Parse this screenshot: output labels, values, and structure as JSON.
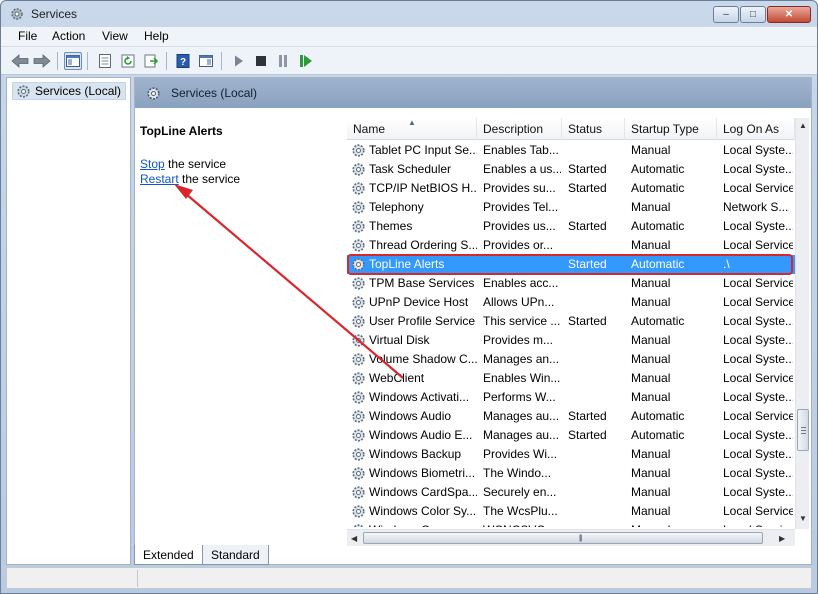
{
  "window": {
    "title": "Services",
    "minimize_glyph": "–",
    "maximize_glyph": "□",
    "close_glyph": "✕"
  },
  "menu": {
    "file": "File",
    "action": "Action",
    "view": "View",
    "help": "Help"
  },
  "toolbar": {
    "buttons": [
      "back-icon",
      "forward-icon",
      "show-hide-console-tree-icon",
      "properties-icon",
      "refresh-icon",
      "export-list-icon",
      "help-icon",
      "action-pane-icon",
      "start-service-icon",
      "stop-service-icon",
      "pause-service-icon",
      "restart-service-icon"
    ]
  },
  "tree": {
    "item_label": "Services (Local)"
  },
  "main": {
    "header_title": "Services (Local)"
  },
  "description": {
    "service_title": "TopLine Alerts",
    "stop_link": "Stop",
    "stop_rest": " the service",
    "restart_link": "Restart",
    "restart_rest": " the service"
  },
  "columns": {
    "name": "Name",
    "description": "Description",
    "status": "Status",
    "startup_type": "Startup Type",
    "log_on_as": "Log On As"
  },
  "services": [
    {
      "name": "Tablet PC Input Se...",
      "description": "Enables Tab...",
      "status": "",
      "startup": "Manual",
      "logon": "Local Syste..."
    },
    {
      "name": "Task Scheduler",
      "description": "Enables a us...",
      "status": "Started",
      "startup": "Automatic",
      "logon": "Local Syste..."
    },
    {
      "name": "TCP/IP NetBIOS H...",
      "description": "Provides su...",
      "status": "Started",
      "startup": "Automatic",
      "logon": "Local Service"
    },
    {
      "name": "Telephony",
      "description": "Provides Tel...",
      "status": "",
      "startup": "Manual",
      "logon": "Network S..."
    },
    {
      "name": "Themes",
      "description": "Provides us...",
      "status": "Started",
      "startup": "Automatic",
      "logon": "Local Syste..."
    },
    {
      "name": "Thread Ordering S...",
      "description": "Provides or...",
      "status": "",
      "startup": "Manual",
      "logon": "Local Service"
    },
    {
      "name": "TopLine Alerts",
      "description": "",
      "status": "Started",
      "startup": "Automatic",
      "logon": ".\\"
    },
    {
      "name": "TPM Base Services",
      "description": "Enables acc...",
      "status": "",
      "startup": "Manual",
      "logon": "Local Service"
    },
    {
      "name": "UPnP Device Host",
      "description": "Allows UPn...",
      "status": "",
      "startup": "Manual",
      "logon": "Local Service"
    },
    {
      "name": "User Profile Service",
      "description": "This service ...",
      "status": "Started",
      "startup": "Automatic",
      "logon": "Local Syste..."
    },
    {
      "name": "Virtual Disk",
      "description": "Provides m...",
      "status": "",
      "startup": "Manual",
      "logon": "Local Syste..."
    },
    {
      "name": "Volume Shadow C...",
      "description": "Manages an...",
      "status": "",
      "startup": "Manual",
      "logon": "Local Syste..."
    },
    {
      "name": "WebClient",
      "description": "Enables Win...",
      "status": "",
      "startup": "Manual",
      "logon": "Local Service"
    },
    {
      "name": "Windows Activati...",
      "description": "Performs W...",
      "status": "",
      "startup": "Manual",
      "logon": "Local Syste..."
    },
    {
      "name": "Windows Audio",
      "description": "Manages au...",
      "status": "Started",
      "startup": "Automatic",
      "logon": "Local Service"
    },
    {
      "name": "Windows Audio E...",
      "description": "Manages au...",
      "status": "Started",
      "startup": "Automatic",
      "logon": "Local Syste..."
    },
    {
      "name": "Windows Backup",
      "description": "Provides Wi...",
      "status": "",
      "startup": "Manual",
      "logon": "Local Syste..."
    },
    {
      "name": "Windows Biometri...",
      "description": "The Windo...",
      "status": "",
      "startup": "Manual",
      "logon": "Local Syste..."
    },
    {
      "name": "Windows CardSpa...",
      "description": "Securely en...",
      "status": "",
      "startup": "Manual",
      "logon": "Local Syste..."
    },
    {
      "name": "Windows Color Sy...",
      "description": "The WcsPlu...",
      "status": "",
      "startup": "Manual",
      "logon": "Local Service"
    },
    {
      "name": "Windows Conn...",
      "description": "WCNCSVC...",
      "status": "",
      "startup": "Manual",
      "logon": "Local Service"
    }
  ],
  "selected_service": "TopLine Alerts",
  "tabs": {
    "extended": "Extended",
    "standard": "Standard",
    "active": "Extended"
  },
  "colors": {
    "selection": "#3399ff",
    "annotation": "#d9262c",
    "link": "#1155cc",
    "header_band": "#9fb3cd"
  }
}
